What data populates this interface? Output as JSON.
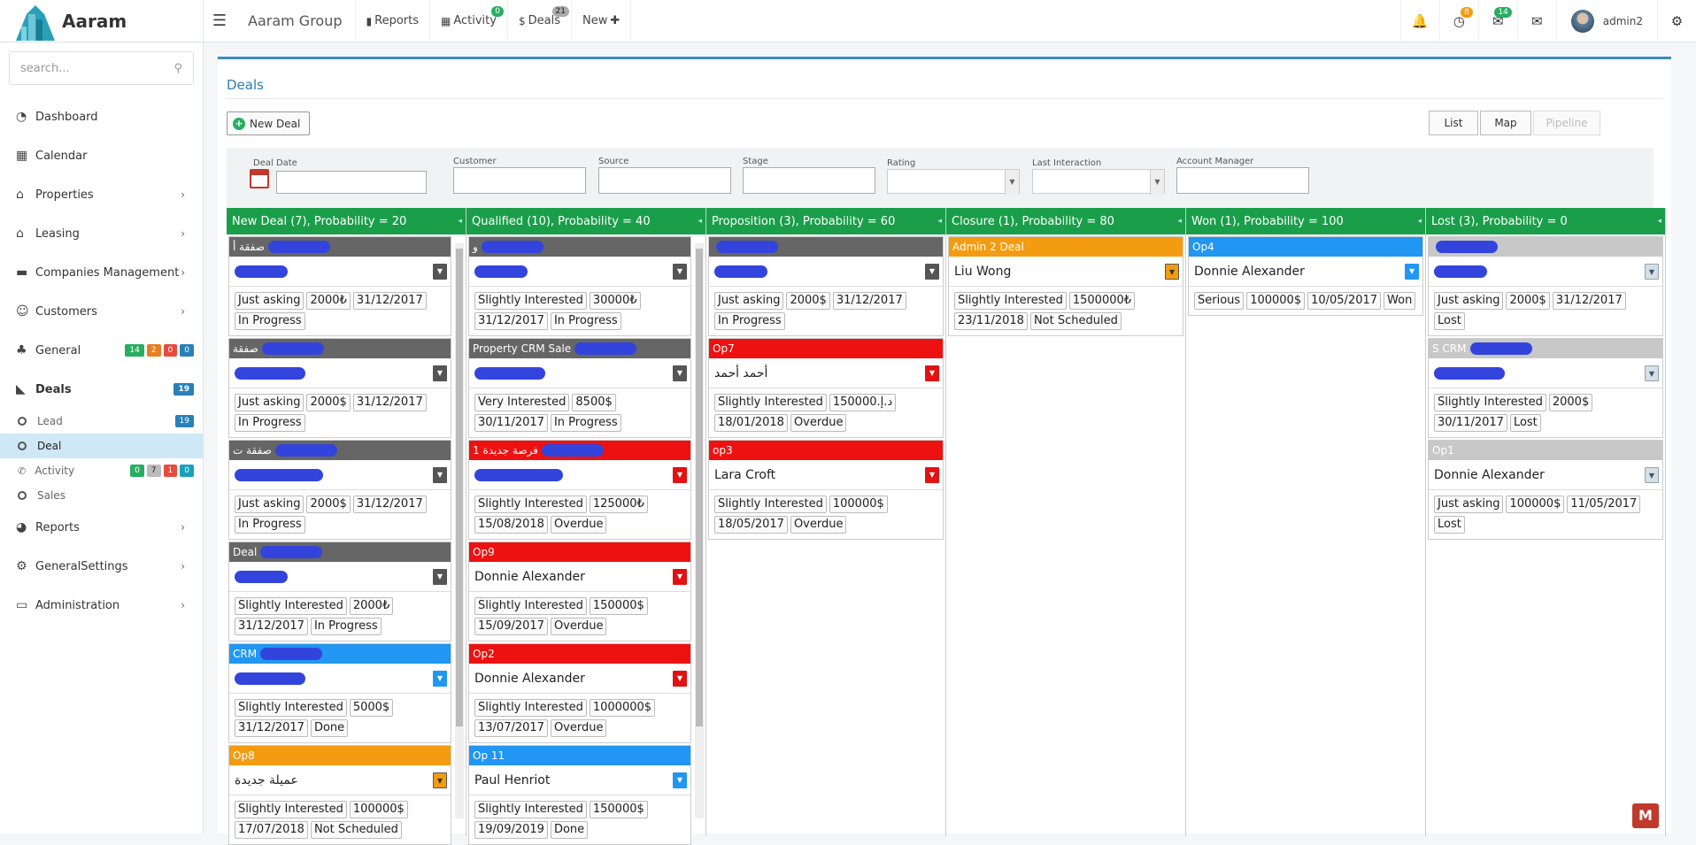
{
  "app": {
    "name": "Aaram"
  },
  "topnav": {
    "group": "Aaram Group",
    "items": [
      {
        "label": "Reports",
        "badge": ""
      },
      {
        "label": "Activity",
        "badge": "0"
      },
      {
        "label": "Deals",
        "badge": "21"
      },
      {
        "label": "New",
        "badge": ""
      }
    ],
    "right_badges": {
      "clock": "8",
      "comments": "14"
    },
    "user": "admin2"
  },
  "sidebar": {
    "search_placeholder": "search...",
    "items": [
      {
        "label": "Dashboard"
      },
      {
        "label": "Calendar"
      },
      {
        "label": "Properties"
      },
      {
        "label": "Leasing"
      },
      {
        "label": "Companies Management"
      },
      {
        "label": "Customers"
      },
      {
        "label": "General",
        "badges": [
          "14",
          "2",
          "0",
          "0"
        ]
      },
      {
        "label": "Deals",
        "badge": "19"
      },
      {
        "label": "Reports"
      },
      {
        "label": "GeneralSettings"
      },
      {
        "label": "Administration"
      }
    ],
    "sub_items": [
      {
        "label": "Lead",
        "badge": "19"
      },
      {
        "label": "Deal"
      },
      {
        "label": "Activity",
        "badges": [
          "0",
          "7",
          "1",
          "0"
        ]
      },
      {
        "label": "Sales"
      }
    ]
  },
  "main": {
    "title": "Deals",
    "new_deal": "New Deal",
    "views": [
      "List",
      "Map",
      "Pipeline"
    ],
    "filters": [
      "Deal Date",
      "Customer",
      "Source",
      "Stage",
      "Rating",
      "Last Interaction",
      "Account Manager"
    ]
  },
  "columns": [
    {
      "header": "New Deal (7), Probability = 20",
      "cards": [
        {
          "title": "صفقة أ",
          "name": "",
          "color": "dark",
          "tags": [
            "Just asking",
            "2000₺",
            "31/12/2017",
            "In Progress"
          ]
        },
        {
          "title": "صفقة",
          "name": "",
          "color": "dark",
          "tags": [
            "Just asking",
            "2000$",
            "31/12/2017",
            "In Progress"
          ]
        },
        {
          "title": "صفقة ت",
          "name": "",
          "color": "dark",
          "tags": [
            "Just asking",
            "2000$",
            "31/12/2017",
            "In Progress"
          ]
        },
        {
          "title": "Deal",
          "name": "",
          "color": "dark",
          "tags": [
            "Slightly Interested",
            "2000₺",
            "31/12/2017",
            "In Progress"
          ]
        },
        {
          "title": "CRM",
          "name": "",
          "color": "blue",
          "tags": [
            "Slightly Interested",
            "5000$",
            "31/12/2017",
            "Done"
          ]
        },
        {
          "title": "Op8",
          "name": "عميلة جديدة",
          "color": "orange",
          "tags": [
            "Slightly Interested",
            "100000$",
            "17/07/2018",
            "Not Scheduled"
          ]
        }
      ]
    },
    {
      "header": "Qualified (10), Probability = 40",
      "cards": [
        {
          "title": "و",
          "name": "",
          "color": "dark",
          "tags": [
            "Slightly Interested",
            "30000₺",
            "31/12/2017",
            "In Progress"
          ]
        },
        {
          "title": "Property CRM Sale",
          "name": "",
          "color": "dark",
          "tags": [
            "Very Interested",
            "8500$",
            "30/11/2017",
            "In Progress"
          ]
        },
        {
          "title": "1 فرصة جديدة",
          "name": "",
          "color": "red",
          "tags": [
            "Slightly Interested",
            "125000₺",
            "15/08/2018",
            "Overdue"
          ]
        },
        {
          "title": "Op9",
          "name": "Donnie Alexander",
          "color": "red",
          "tags": [
            "Slightly Interested",
            "150000$",
            "15/09/2017",
            "Overdue"
          ]
        },
        {
          "title": "Op2",
          "name": "Donnie Alexander",
          "color": "red",
          "tags": [
            "Slightly Interested",
            "1000000$",
            "13/07/2017",
            "Overdue"
          ]
        },
        {
          "title": "Op 11",
          "name": "Paul Henriot",
          "color": "blue",
          "tags": [
            "Slightly Interested",
            "150000$",
            "19/09/2019",
            "Done"
          ]
        }
      ]
    },
    {
      "header": "Proposition (3), Probability = 60",
      "cards": [
        {
          "title": "",
          "name": "",
          "color": "dark",
          "tags": [
            "Just asking",
            "2000$",
            "31/12/2017",
            "In Progress"
          ]
        },
        {
          "title": "Op7",
          "name": "أحمد أحمد",
          "color": "red",
          "tags": [
            "Slightly Interested",
            "150000.د.إ",
            "18/01/2018",
            "Overdue"
          ]
        },
        {
          "title": "op3",
          "name": "Lara Croft",
          "color": "red",
          "tags": [
            "Slightly Interested",
            "100000$",
            "18/05/2017",
            "Overdue"
          ]
        }
      ]
    },
    {
      "header": "Closure (1), Probability = 80",
      "cards": [
        {
          "title": "Admin 2 Deal",
          "name": "Liu Wong",
          "color": "orange",
          "tags": [
            "Slightly Interested",
            "1500000₺",
            "23/11/2018",
            "Not Scheduled"
          ]
        }
      ]
    },
    {
      "header": "Won (1), Probability = 100",
      "cards": [
        {
          "title": "Op4",
          "name": "Donnie Alexander",
          "color": "blue",
          "tags": [
            "Serious",
            "100000$",
            "10/05/2017",
            "Won"
          ]
        }
      ]
    },
    {
      "header": "Lost (3), Probability = 0",
      "cards": [
        {
          "title": "",
          "name": "",
          "color": "lite",
          "tags": [
            "Just asking",
            "2000$",
            "31/12/2017",
            "Lost"
          ]
        },
        {
          "title": "S CRM",
          "name": "",
          "color": "lite",
          "tags": [
            "Slightly Interested",
            "2000$",
            "30/11/2017",
            "Lost"
          ]
        },
        {
          "title": "Op1",
          "name": "Donnie Alexander",
          "color": "lite",
          "tags": [
            "Just asking",
            "100000$",
            "11/05/2017",
            "Lost"
          ]
        }
      ]
    }
  ]
}
